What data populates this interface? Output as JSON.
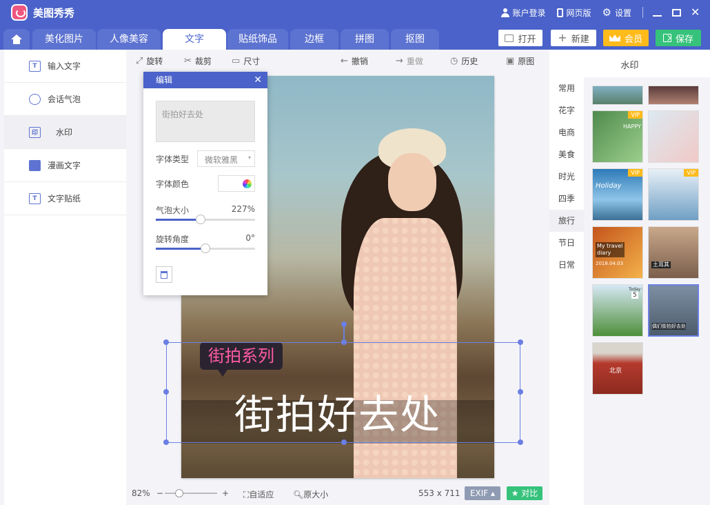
{
  "app": {
    "name": "美图秀秀"
  },
  "titlebar": {
    "login": "账户登录",
    "web": "网页版",
    "settings": "设置"
  },
  "tabs": [
    "美化图片",
    "人像美容",
    "文字",
    "贴纸饰品",
    "边框",
    "拼图",
    "抠图"
  ],
  "active_tab": "文字",
  "actions": {
    "open": "打开",
    "new": "新建",
    "vip": "会员",
    "save": "保存"
  },
  "left_menu": [
    {
      "label": "输入文字",
      "icon": "text-box-icon"
    },
    {
      "label": "会话气泡",
      "icon": "speech-bubble-icon"
    },
    {
      "label": "水印",
      "icon": "watermark-icon"
    },
    {
      "label": "漫画文字",
      "icon": "comic-icon"
    },
    {
      "label": "文字贴纸",
      "icon": "text-sticker-icon"
    }
  ],
  "left_active": "水印",
  "toolbar": {
    "rotate": "旋转",
    "crop": "裁剪",
    "size": "尺寸",
    "undo": "撤销",
    "redo": "重做",
    "history": "历史",
    "original": "原图"
  },
  "edit_panel": {
    "title": "编辑",
    "text_value": "街拍好去处",
    "font_type_label": "字体类型",
    "font_type_value": "微软雅黑",
    "font_color_label": "字体颜色",
    "bubble_size_label": "气泡大小",
    "bubble_size_value": "227%",
    "bubble_size_level": 0.45,
    "rotate_label": "旋转角度",
    "rotate_value": "0°",
    "rotate_level": 0.5
  },
  "watermark": {
    "tag": "街拍系列",
    "main": "街拍好去处"
  },
  "status": {
    "zoom": "82%",
    "zoom_level": 0.25,
    "fit": "自适应",
    "original_size": "原大小",
    "dimensions": "553 x 711",
    "exif": "EXIF",
    "compare": "对比"
  },
  "right_panel": {
    "title": "水印",
    "categories": [
      "常用",
      "花字",
      "电商",
      "美食",
      "时光",
      "四季",
      "旅行",
      "节日",
      "日常"
    ],
    "active_category": "旅行",
    "vip_label": "VIP",
    "thumb_texts": {
      "t1": "HAPPY WORLD",
      "t3": "Holiday",
      "t5": "My travel diary",
      "t5b": "2018.04.03",
      "t6": "土耳其",
      "t7": "Today is",
      "t7b": "5",
      "t8": "偶们街拍好去处",
      "t9": "北京"
    }
  }
}
